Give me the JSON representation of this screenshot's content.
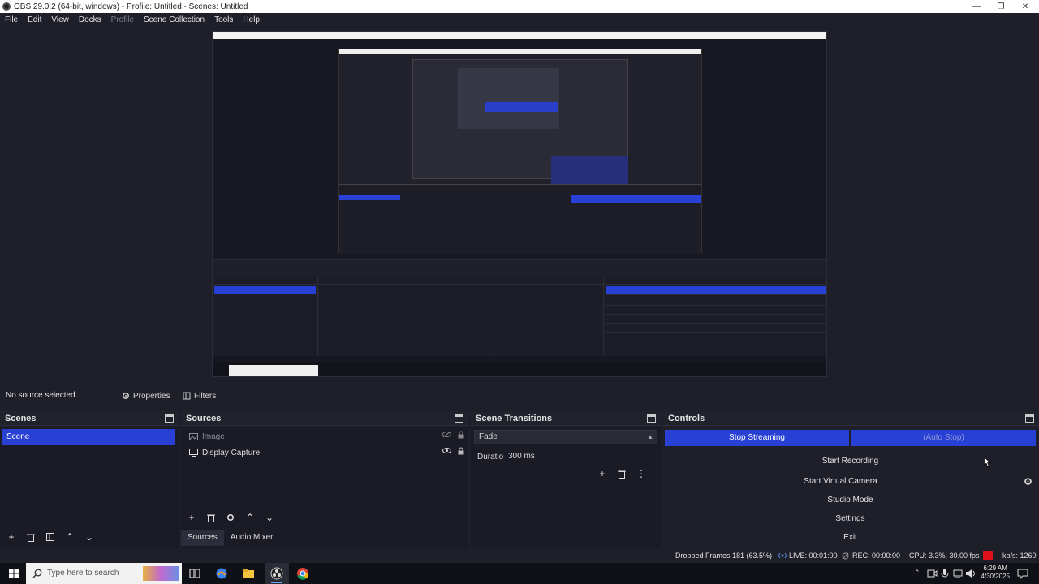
{
  "window": {
    "title": "OBS 29.0.2 (64-bit, windows) - Profile: Untitled - Scenes: Untitled",
    "minimize": "—",
    "restore": "❐",
    "close": "✕"
  },
  "menu": {
    "items": [
      "File",
      "Edit",
      "View",
      "Docks",
      "Profile",
      "Scene Collection",
      "Tools",
      "Help"
    ]
  },
  "context": {
    "no_source": "No source selected",
    "properties": "Properties",
    "filters": "Filters"
  },
  "scenes": {
    "title": "Scenes",
    "items": [
      "Scene"
    ]
  },
  "sources": {
    "title": "Sources",
    "items": [
      "Image",
      "Display Capture"
    ],
    "tabs": [
      "Sources",
      "Audio Mixer"
    ]
  },
  "transitions": {
    "title": "Scene Transitions",
    "selected": "Fade",
    "duration_label": "Duration",
    "duration_value": "300 ms"
  },
  "controls": {
    "title": "Controls",
    "stop_streaming": "Stop Streaming",
    "auto_stop": "(Auto Stop)",
    "start_recording": "Start Recording",
    "start_virtual_camera": "Start Virtual Camera",
    "studio_mode": "Studio Mode",
    "settings": "Settings",
    "exit": "Exit"
  },
  "status": {
    "dropped": "Dropped Frames 181 (63.5%)",
    "live": "LIVE: 00:01:00",
    "rec": "REC: 00:00:00",
    "cpu": "CPU: 3.3%, 30.00 fps",
    "kbs": "kb/s: 1260"
  },
  "taskbar": {
    "search_placeholder": "Type here to search",
    "time": "6:29 AM",
    "date": "4/30/2025"
  },
  "colors": {
    "accent": "#2840d4",
    "background": "#1e1f29",
    "record_indicator": "#e0101a"
  }
}
